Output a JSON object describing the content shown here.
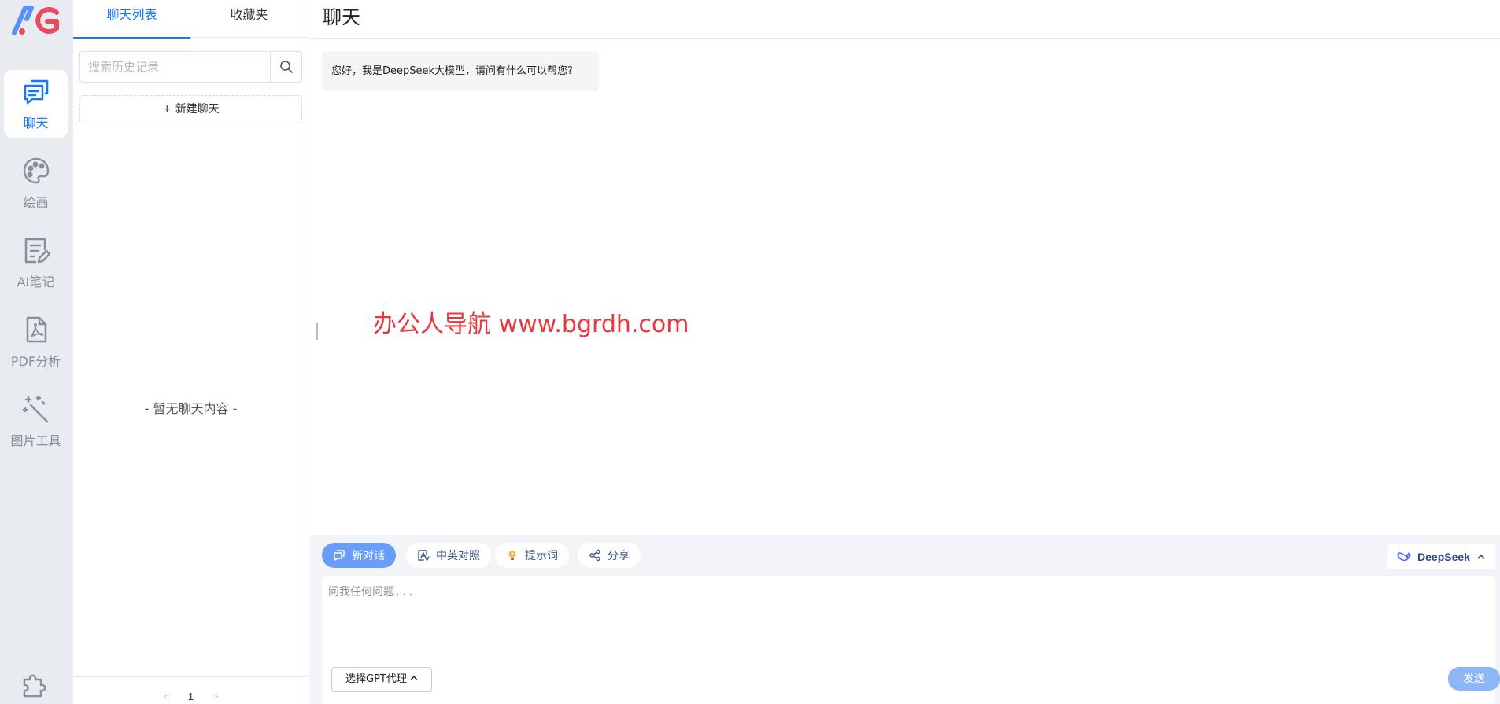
{
  "brand": {
    "logo_icon": "ag-logo-icon",
    "logo_colors": [
      "#5b8ff9",
      "#e84a5f"
    ]
  },
  "rail": {
    "items": [
      {
        "label": "聊天",
        "icon": "chat-icon",
        "active": true
      },
      {
        "label": "绘画",
        "icon": "palette-icon",
        "active": false
      },
      {
        "label": "AI笔记",
        "icon": "note-icon",
        "active": false
      },
      {
        "label": "PDF分析",
        "icon": "pdf-icon",
        "active": false
      },
      {
        "label": "图片工具",
        "icon": "magic-wand-icon",
        "active": false
      }
    ],
    "bottom_icon": "puzzle-icon"
  },
  "list_panel": {
    "tabs": [
      {
        "label": "聊天列表",
        "active": true
      },
      {
        "label": "收藏夹",
        "active": false
      }
    ],
    "search": {
      "placeholder": "搜索历史记录",
      "value": ""
    },
    "new_chat_label": "+ 新建聊天",
    "empty_text": "- 暂无聊天内容 -",
    "pager": {
      "prev": "<",
      "page": "1",
      "next": ">"
    }
  },
  "main": {
    "title": "聊天",
    "welcome_message": "您好，我是DeepSeek大模型，请问有什么可以帮您?",
    "watermark": "办公人导航  www.bgrdh.com",
    "toolbar": {
      "new_chat": "新对话",
      "translate": "中英对照",
      "prompt": "提示词",
      "share": "分享"
    },
    "model": {
      "name": "DeepSeek",
      "icon": "whale-icon"
    },
    "input": {
      "placeholder": "问我任何问题...",
      "value": ""
    },
    "agent_button": "选择GPT代理",
    "send_button": "发送"
  },
  "colors": {
    "accent": "#1677ff",
    "primary_chip": "#6a9df7",
    "send": "#8cb6f5",
    "watermark": "#e8383d",
    "rail_bg": "#e8ebf0"
  }
}
